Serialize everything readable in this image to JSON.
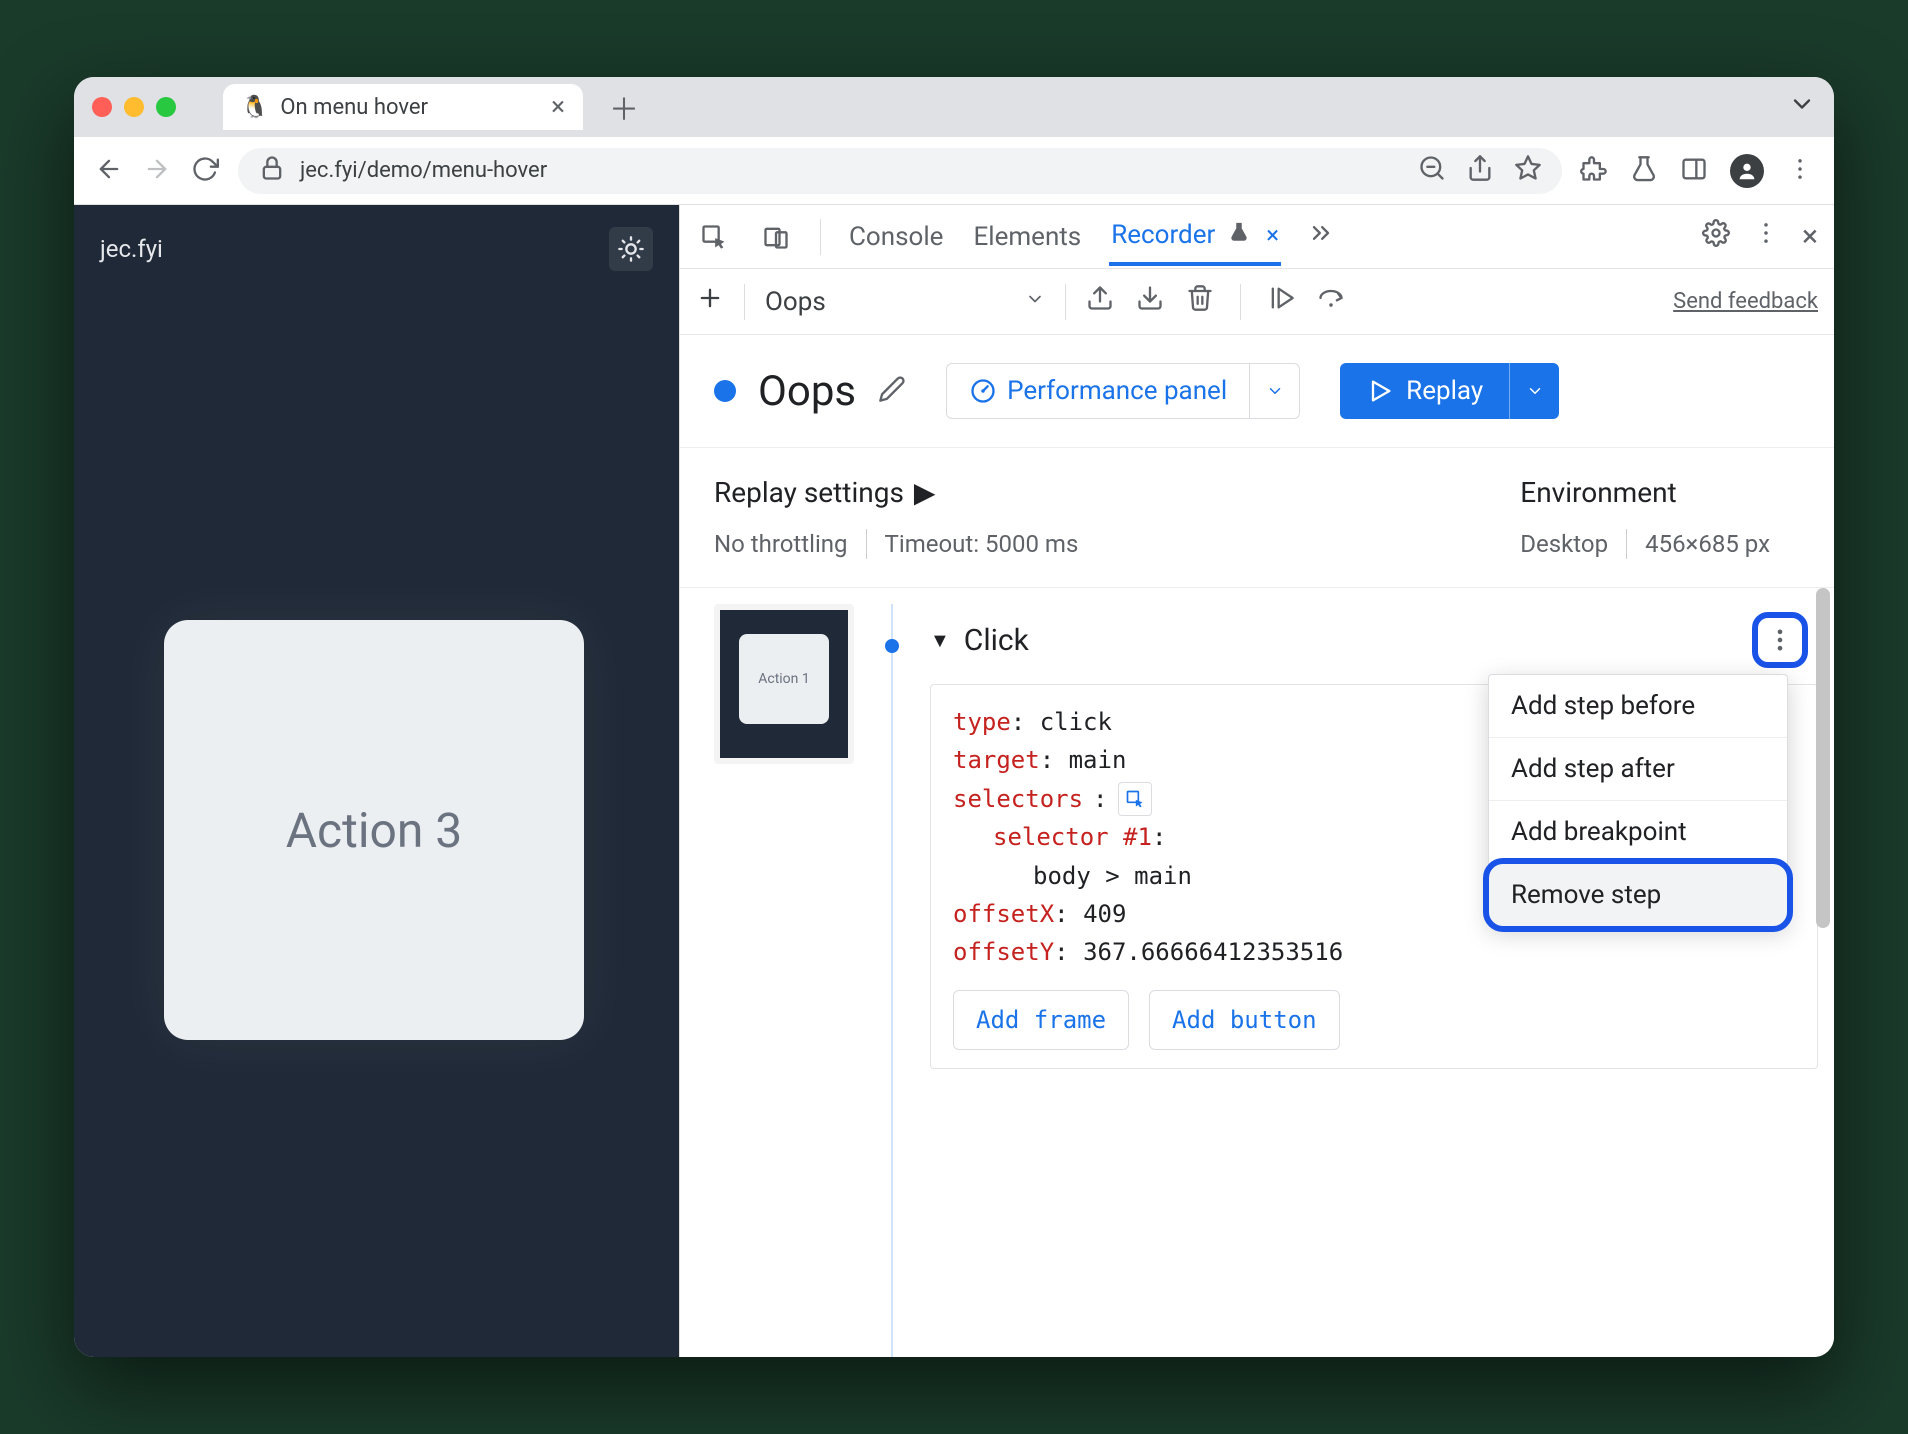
{
  "browser": {
    "tab_title": "On menu hover",
    "url": "jec.fyi/demo/menu-hover"
  },
  "page": {
    "logo": "jec.fyi",
    "card_label": "Action 3"
  },
  "devtools": {
    "tabs": {
      "console": "Console",
      "elements": "Elements",
      "recorder": "Recorder"
    },
    "recorder_toolbar": {
      "recording_name": "Oops",
      "feedback": "Send feedback"
    },
    "recorder_header": {
      "title": "Oops",
      "perf_button": "Performance panel",
      "replay_button": "Replay"
    },
    "settings": {
      "replay_title": "Replay settings",
      "throttling": "No throttling",
      "timeout": "Timeout: 5000 ms",
      "env_title": "Environment",
      "env_device": "Desktop",
      "env_viewport": "456×685 px"
    },
    "step": {
      "thumb_label": "Action 1",
      "title": "Click",
      "props": {
        "type_key": "type",
        "type_val": "click",
        "target_key": "target",
        "target_val": "main",
        "selectors_key": "selectors",
        "selector_label": "selector #1",
        "selector_val": "body > main",
        "offsetX_key": "offsetX",
        "offsetX_val": "409",
        "offsetY_key": "offsetY",
        "offsetY_val": "367.66666412353516"
      },
      "buttons": {
        "add_frame": "Add frame",
        "add_button": "Add button"
      },
      "ctx": {
        "before": "Add step before",
        "after": "Add step after",
        "breakpoint": "Add breakpoint",
        "remove": "Remove step"
      }
    }
  }
}
